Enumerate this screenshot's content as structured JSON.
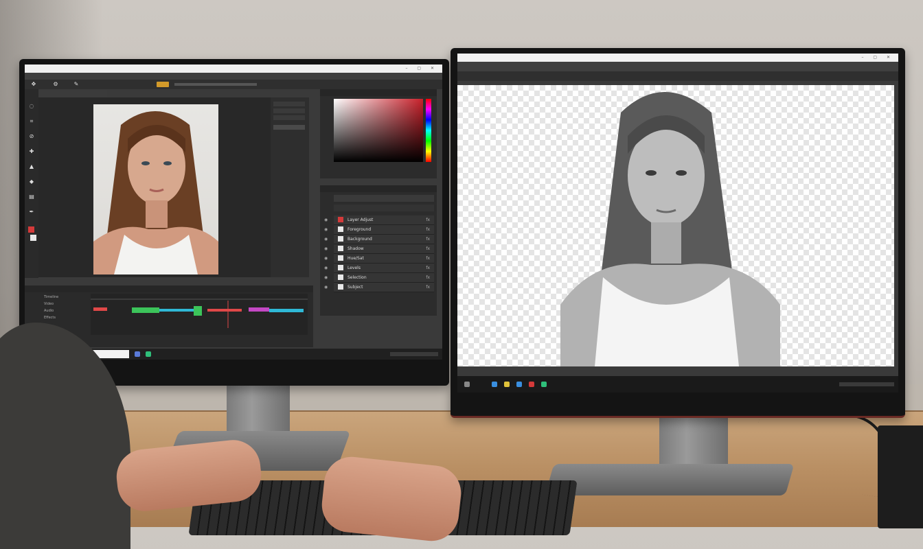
{
  "scene": {
    "description_free": true,
    "left_monitor": {
      "app": "photo-editor",
      "taskbar_search_placeholder": "",
      "layers": [
        {
          "label": "Layer Adjust",
          "value": "fx"
        },
        {
          "label": "Foreground",
          "value": "fx"
        },
        {
          "label": "Background",
          "value": "fx"
        },
        {
          "label": "Shadow",
          "value": "fx"
        },
        {
          "label": "Hue/Sat",
          "value": "fx"
        },
        {
          "label": "Levels",
          "value": "fx"
        },
        {
          "label": "Selection",
          "value": "fx"
        },
        {
          "label": "Subject",
          "value": "fx"
        }
      ],
      "timeline_labels": [
        "Timeline",
        "Video",
        "Audio",
        "Effects"
      ],
      "colors": {
        "ui_bg": "#3a3a3a",
        "panel_bg": "#2c2c2c",
        "timeline_red": "#e04848",
        "timeline_green": "#3cc45a",
        "timeline_cyan": "#2fb8d6",
        "timeline_magenta": "#c448c4"
      }
    },
    "right_monitor": {
      "app": "photo-editor",
      "canvas": "transparent-background",
      "colors": {
        "checker_light": "#ffffff",
        "checker_dark": "#e4e4e4"
      }
    }
  }
}
